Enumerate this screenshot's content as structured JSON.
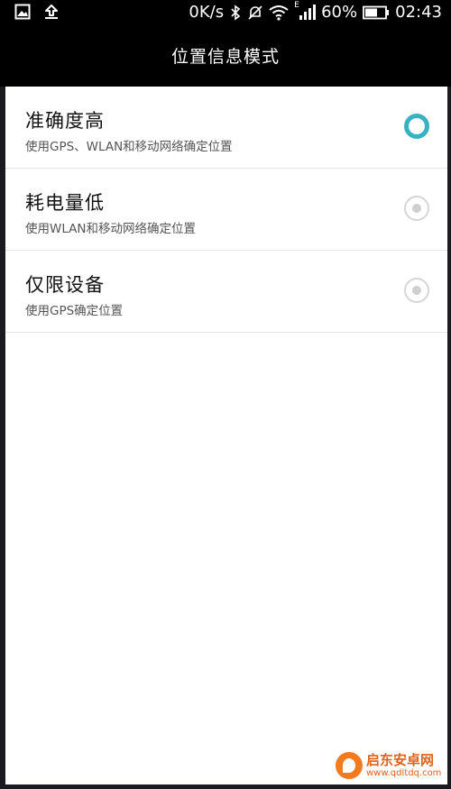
{
  "status_bar": {
    "speed": "0K/s",
    "signal_label": "E",
    "battery": "60%",
    "time": "02:43"
  },
  "header": {
    "title": "位置信息模式"
  },
  "options": [
    {
      "title": "准确度高",
      "desc": "使用GPS、WLAN和移动网络确定位置",
      "selected": true
    },
    {
      "title": "耗电量低",
      "desc": "使用WLAN和移动网络确定位置",
      "selected": false
    },
    {
      "title": "仅限设备",
      "desc": "使用GPS确定位置",
      "selected": false
    }
  ],
  "watermark": {
    "name": "启东安卓网",
    "url": "www.qdltdq.com"
  },
  "colors": {
    "accent": "#36b2c2",
    "status_bg": "#000000"
  }
}
